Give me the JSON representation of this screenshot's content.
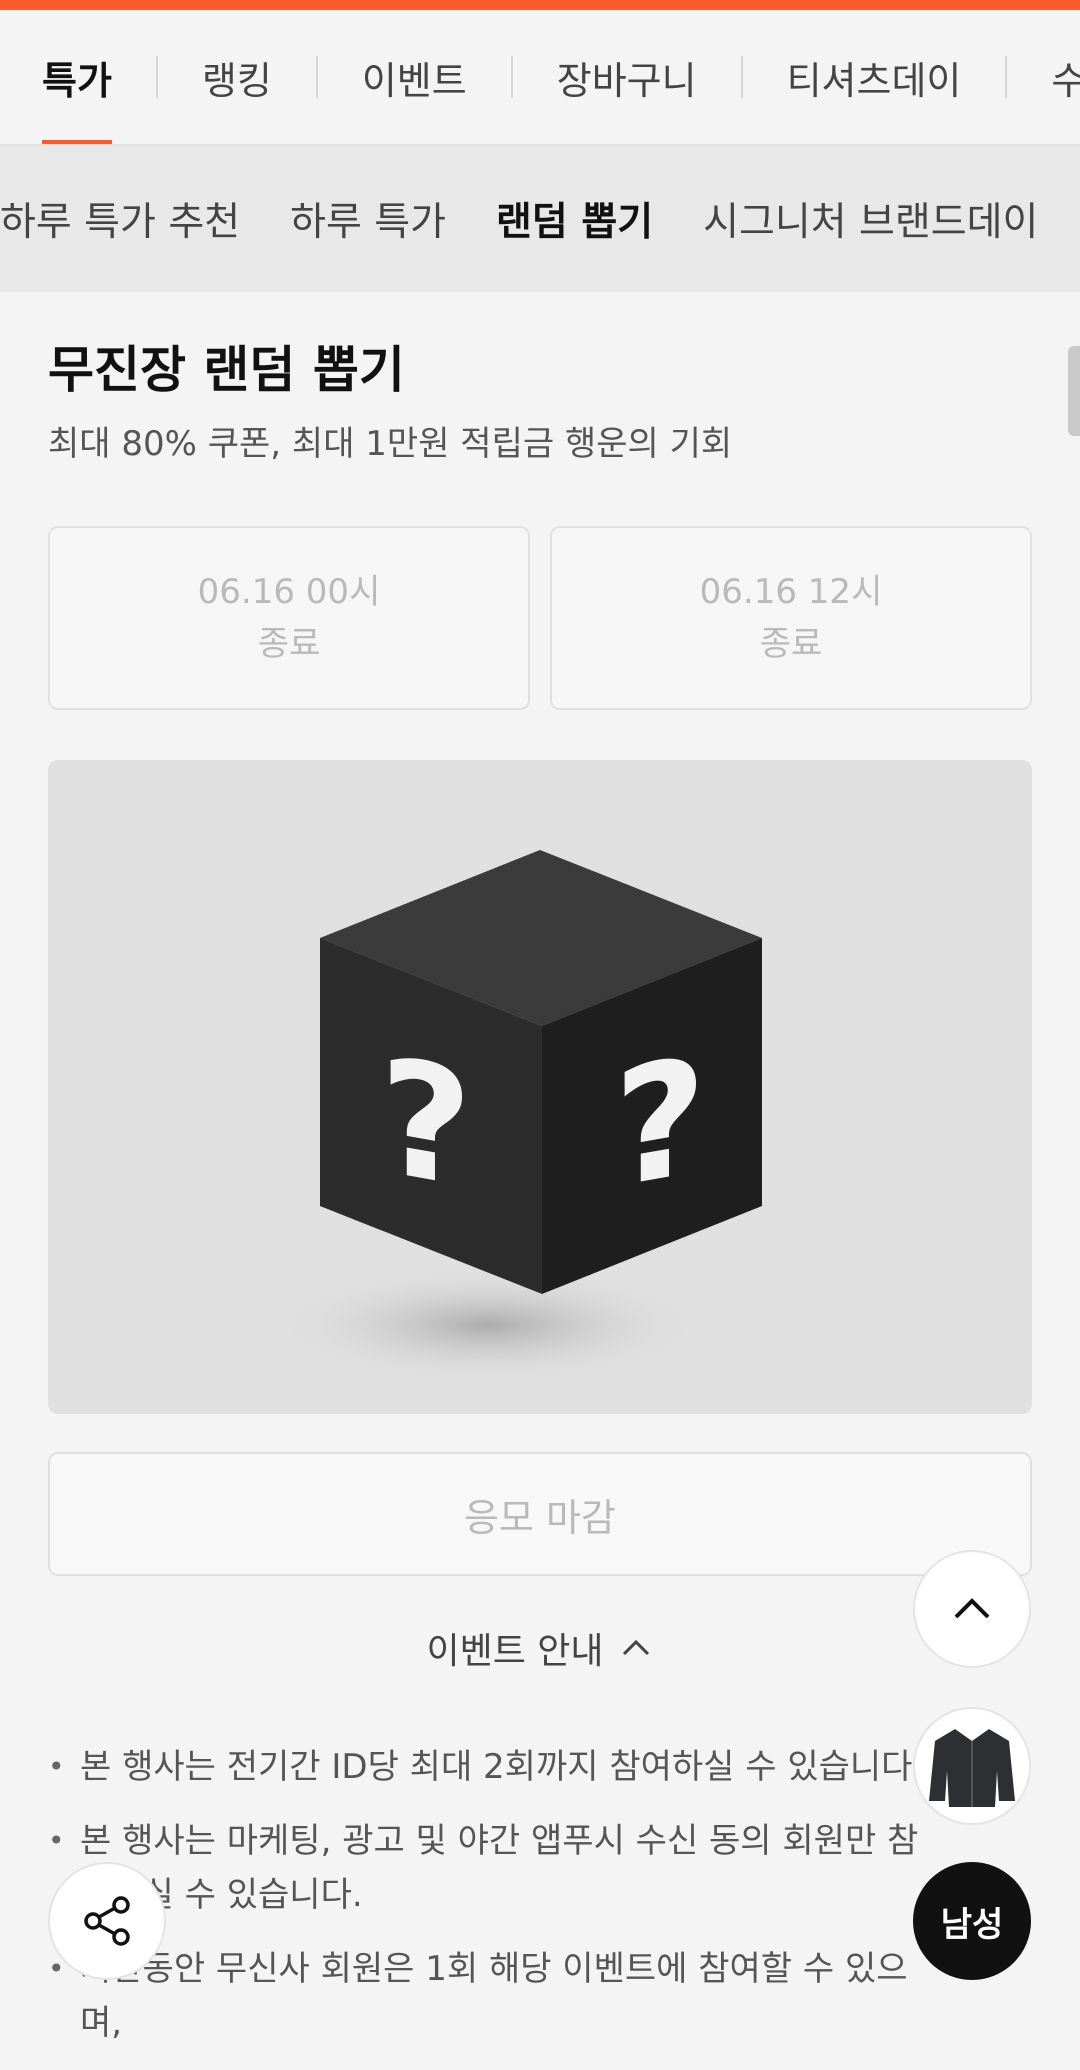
{
  "colors": {
    "accent": "#ff5a2c",
    "text": "#111111",
    "muted": "#b9b9b9"
  },
  "tabs": [
    {
      "label": "특가",
      "active": true
    },
    {
      "label": "랭킹",
      "active": false
    },
    {
      "label": "이벤트",
      "active": false
    },
    {
      "label": "장바구니",
      "active": false
    },
    {
      "label": "티셔츠데이",
      "active": false
    },
    {
      "label": "수",
      "active": false
    }
  ],
  "subnav": [
    {
      "label": "하루 특가 추천",
      "active": false
    },
    {
      "label": "하루 특가",
      "active": false
    },
    {
      "label": "랜덤 뽑기",
      "active": true
    },
    {
      "label": "시그니처 브랜드데이",
      "active": false
    }
  ],
  "event": {
    "title": "무진장 랜덤 뽑기",
    "subtitle": "최대 80% 쿠폰, 최대 1만원 적립금 행운의 기회",
    "slots": [
      {
        "time": "06.16 00시",
        "status": "종료"
      },
      {
        "time": "06.16 12시",
        "status": "종료"
      }
    ],
    "hero_icon": "mystery-box",
    "apply_label": "응모 마감"
  },
  "info": {
    "toggle_label": "이벤트 안내",
    "notes": [
      "본 행사는 전기간 ID당 최대 2회까지 참여하실 수 있습니다.",
      "본 행사는 마케팅, 광고 및 야간 앱푸시 수신 동의 회원만 참여하실 수 있습니다.",
      "기간동안 무신사 회원은 1회 해당 이벤트에 참여할 수 있으며,"
    ]
  },
  "floating": {
    "up_icon": "chevron-up-icon",
    "product_icon": "jacket-thumbnail",
    "gender_label": "남성",
    "share_icon": "share-icon"
  }
}
